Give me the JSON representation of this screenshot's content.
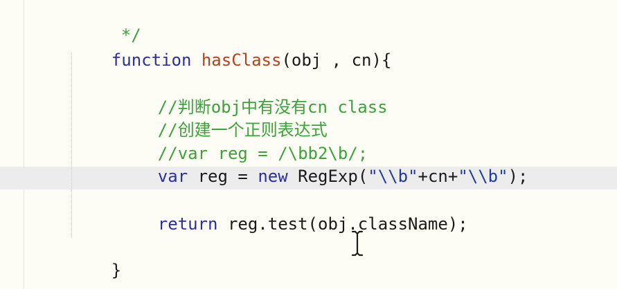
{
  "code": {
    "line_comment_end": "*/",
    "line_function": {
      "keyword": "function",
      "name": "hasClass",
      "params": "(obj , cn){"
    },
    "line_comment_1": "//判断obj中有没有cn class",
    "line_comment_2": "//创建一个正则表达式",
    "line_comment_3": "//var reg = /\\bb2\\b/;",
    "line_var": {
      "keyword": "var",
      "mid1": " reg = ",
      "new_keyword": "new",
      "call": " RegExp(",
      "string1": "\"\\\\b\"",
      "concat": "+cn+",
      "string2": "\"\\\\b\"",
      "end": ");"
    },
    "line_return": {
      "keyword": "return",
      "rest": " reg.test(obj.className);"
    },
    "line_close": "}"
  },
  "colors": {
    "background": "#fdfdf5",
    "keyword": "#2a2fa0",
    "function_name": "#b3421b",
    "comment": "#3aa238",
    "string": "#1f3aa0",
    "current_line": "#ececec"
  },
  "icons": {
    "cursor": "i-beam-cursor-icon"
  }
}
